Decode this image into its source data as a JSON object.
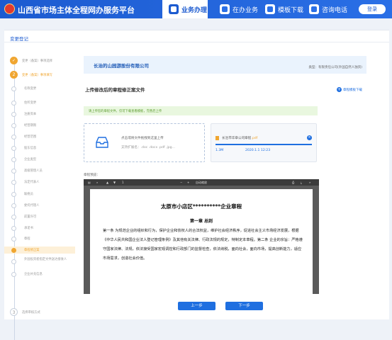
{
  "header": {
    "title": "山西省市场主体全程网办服务平台",
    "nav": [
      {
        "label": "业务办理",
        "icon": "briefcase-icon",
        "active": true
      },
      {
        "label": "在办业务",
        "icon": "clipboard-icon",
        "active": false
      },
      {
        "label": "模板下载",
        "icon": "download-icon",
        "active": false
      },
      {
        "label": "咨询电话",
        "icon": "phone-icon",
        "active": false
      }
    ],
    "login": "登录"
  },
  "page": {
    "title": "变更登记"
  },
  "steps": [
    {
      "label": "变更（备案）事项选择",
      "state": "done",
      "num": "✓"
    },
    {
      "label": "变更（备案）事项填写",
      "state": "current",
      "num": "2"
    },
    {
      "label": "名称变更",
      "state": "sub"
    },
    {
      "label": "住所变更",
      "state": "sub"
    },
    {
      "label": "注册资本",
      "state": "sub"
    },
    {
      "label": "经营期限",
      "state": "sub"
    },
    {
      "label": "经营范围",
      "state": "sub"
    },
    {
      "label": "股东信息",
      "state": "sub"
    },
    {
      "label": "企业类型",
      "state": "sub"
    },
    {
      "label": "高级管理人员",
      "state": "sub"
    },
    {
      "label": "法定代表人",
      "state": "sub"
    },
    {
      "label": "联络员",
      "state": "sub"
    },
    {
      "label": "委托代理人",
      "state": "sub"
    },
    {
      "label": "前置许可",
      "state": "sub"
    },
    {
      "label": "承诺书",
      "state": "sub"
    },
    {
      "label": "章程",
      "state": "sub"
    },
    {
      "label": "章程修正案",
      "state": "highlight"
    },
    {
      "label": "外国投资者指定文件送达接收人",
      "state": "sub"
    },
    {
      "label": "企业补充信息",
      "state": "sub"
    },
    {
      "label": "选择审核方式",
      "state": "todo",
      "num": "3"
    }
  ],
  "company": {
    "name": "长治的山园游股份有限公司",
    "type": "类型：有限责任公司(外国自然人独资)"
  },
  "section": {
    "title": "上传修改后的章程修正案文件",
    "download_template": "章程模板下载"
  },
  "tip": "请上传您的章程文件，仅可下载查看模板，完善后上传",
  "upload": {
    "line1": "点击或将文件拖拽到这里上传",
    "line2": "支持扩展名：.doc .docx .pdf .jpg..."
  },
  "file": {
    "name_prefix": "长治市华章公司章程",
    "ext": ".pdf",
    "size": "1.3M",
    "date": "2020.1.1 12:23"
  },
  "preview": {
    "label": "章程预览：",
    "toolbar": {
      "page": "1",
      "zoom": "自动缩放"
    },
    "doc_title": "太原市小店区**********企业章程",
    "chapter": "第一章 总则",
    "body": "第一条 为规范企业的组织和行为，保护企业和债权人的合法权益，维护社会经济秩序，促进社会主义市场经济发展，根据《中华人民共和国企业法人登记管理条例》及其他有关法律、行政法规的规定，特制定本章程。第二条 企业的宗旨：严格遵守国家法律、法规，依法接受国家宏观调控和行政部门的监督检查，依法纳税，面向社会，面向市场，提高创新能力，适应市场需求，创造社会价值。"
  },
  "buttons": {
    "prev": "上一步",
    "next": "下一步"
  },
  "colors": {
    "primary": "#1f6fe0",
    "accent": "#f0a631",
    "header": "#1c5bd0",
    "tip_bg": "#e9f7df"
  }
}
